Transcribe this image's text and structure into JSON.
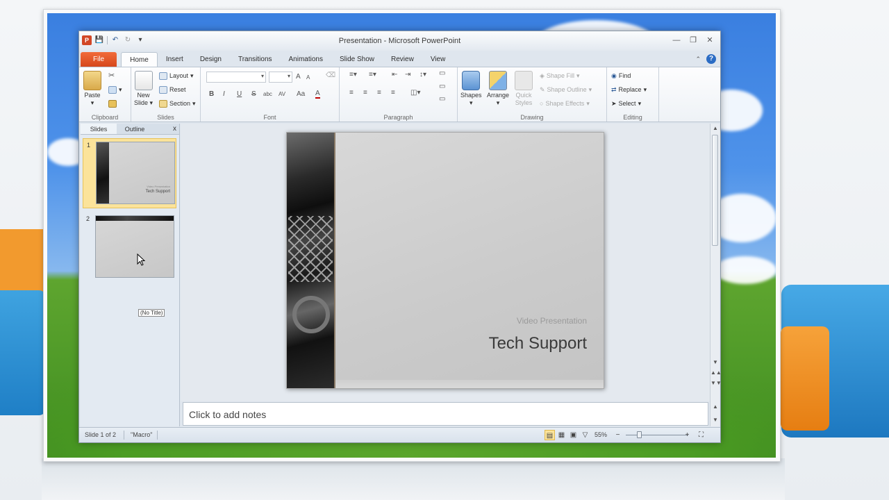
{
  "window": {
    "title": "Presentation  -  Microsoft PowerPoint",
    "app_icon": "P"
  },
  "ribbon_tabs": [
    "File",
    "Home",
    "Insert",
    "Design",
    "Transitions",
    "Animations",
    "Slide Show",
    "Review",
    "View"
  ],
  "active_tab": "Home",
  "ribbon": {
    "clipboard": {
      "paste": "Paste",
      "label": "Clipboard"
    },
    "slides": {
      "new_slide_line1": "New",
      "new_slide_line2": "Slide",
      "layout": "Layout",
      "reset": "Reset",
      "section": "Section",
      "label": "Slides"
    },
    "font": {
      "label": "Font",
      "bold": "B",
      "italic": "I",
      "underline": "U",
      "strike": "S",
      "shadow": "abc",
      "spacing": "AV",
      "case": "Aa",
      "color": "A",
      "grow": "A",
      "shrink": "A"
    },
    "paragraph": {
      "label": "Paragraph"
    },
    "drawing": {
      "shapes": "Shapes",
      "arrange": "Arrange",
      "quick_styles_line1": "Quick",
      "quick_styles_line2": "Styles",
      "shape_fill": "Shape Fill",
      "shape_outline": "Shape Outline",
      "shape_effects": "Shape Effects",
      "label": "Drawing"
    },
    "editing": {
      "find": "Find",
      "replace": "Replace",
      "select": "Select",
      "label": "Editing"
    }
  },
  "left_pane": {
    "tabs": [
      "Slides",
      "Outline"
    ],
    "close": "x",
    "thumbnails": [
      {
        "number": "1",
        "subtitle": "Video Presentation",
        "title": "Tech Support",
        "selected": true
      },
      {
        "number": "2",
        "subtitle": "",
        "title": "",
        "selected": false
      }
    ],
    "tooltip": "(No Title)"
  },
  "slide": {
    "subtitle": "Video Presentation",
    "title": "Tech Support"
  },
  "notes": {
    "placeholder": "Click to add notes"
  },
  "status": {
    "slide_info": "Slide 1 of 2",
    "theme": "\"Macro\"",
    "zoom": "55%",
    "zoom_minus": "−",
    "zoom_plus": "+"
  }
}
